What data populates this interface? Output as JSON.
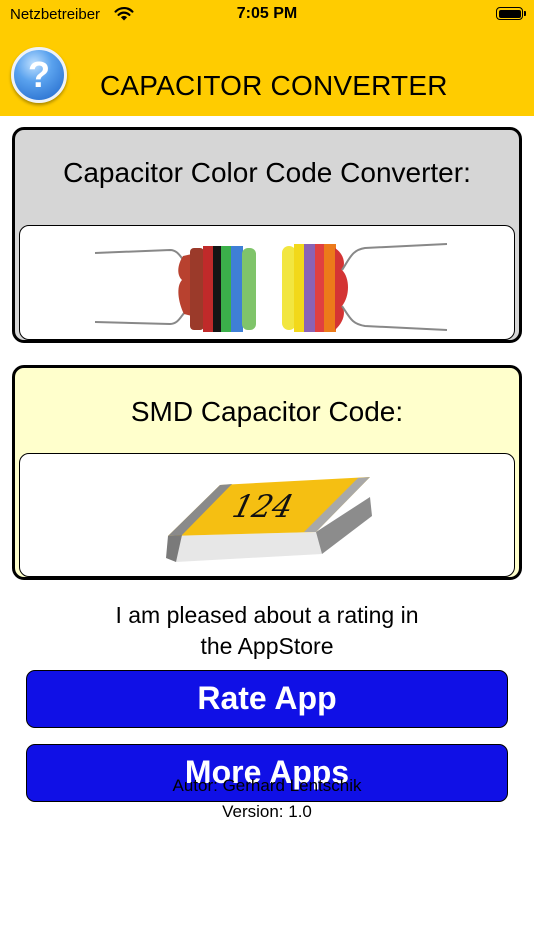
{
  "status_bar": {
    "carrier": "Netzbetreiber",
    "time": "7:05 PM"
  },
  "header": {
    "help_symbol": "?",
    "title": "CAPACITOR CONVERTER",
    "background": "#ffcc00"
  },
  "cards": [
    {
      "title": "Capacitor Color Code Converter:",
      "background": "#d6d6d6"
    },
    {
      "title": "SMD Capacitor Code:",
      "background": "#ffffcc",
      "chip_code": "124"
    }
  ],
  "rating": {
    "line1": "I am pleased about a rating in",
    "line2": "the AppStore"
  },
  "buttons": {
    "rate": "Rate App",
    "more": "More Apps",
    "color": "#1010e6"
  },
  "footer": {
    "author": "Autor: Gerhard Lentschik",
    "version": "Version: 1.0"
  }
}
